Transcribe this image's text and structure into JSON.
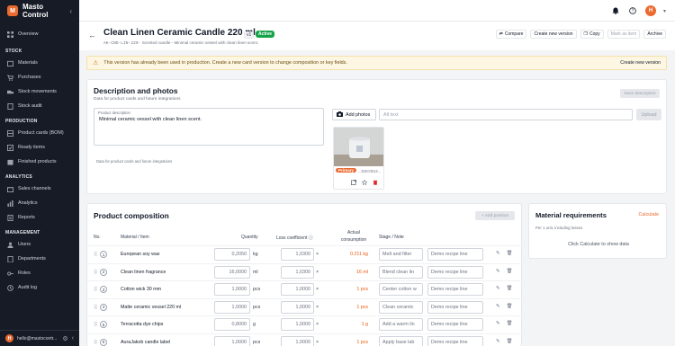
{
  "app": {
    "name": "Masto Control",
    "logo_letter": "M"
  },
  "sidebar": {
    "overview": "Overview",
    "sections": [
      {
        "title": "STOCK",
        "items": [
          "Materials",
          "Purchases",
          "Stock movements",
          "Stock audit"
        ]
      },
      {
        "title": "PRODUCTION",
        "items": [
          "Product cards (BOM)",
          "Ready items",
          "Finished products"
        ]
      },
      {
        "title": "ANALYTICS",
        "items": [
          "Sales channels",
          "Analytics",
          "Reports"
        ]
      },
      {
        "title": "MANAGEMENT",
        "items": [
          "Users",
          "Departments",
          "Roles",
          "Audit log"
        ]
      }
    ],
    "footer": {
      "avatar": "H",
      "email": "hello@mastocontr..."
    }
  },
  "topbar": {
    "avatar": "H"
  },
  "header": {
    "title": "Clean Linen Ceramic Candle 220 ml",
    "version": "v1",
    "status": "Active",
    "sku": "AK-CND-LIN-220",
    "subtitle": "Scented candle - Minimal ceramic vessel with clean linen scent.",
    "actions": {
      "compare": "Compare",
      "new_version": "Create new version",
      "copy": "Copy",
      "mark": "Mark as item",
      "archive": "Archive"
    }
  },
  "warning": {
    "message": "This version has already been used in production. Create a new card version to change composition or key fields.",
    "action": "Create new version"
  },
  "description": {
    "title": "Description and photos",
    "hint": "Data for product cards and future integrations",
    "save": "Save description",
    "field_label": "Product description",
    "field_value": "Minimal ceramic vessel with clean linen scent.",
    "field_hint": "Data for product cards and future integrations",
    "add_photos": "Add photos",
    "alt_placeholder": "Alt text",
    "upload": "Upload",
    "photo": {
      "badge": "Primary",
      "name": "...DSC0014..."
    }
  },
  "composition": {
    "title": "Product composition",
    "add_position": "+ Add position",
    "columns": {
      "no": "No.",
      "material": "Material / Item",
      "quantity": "Quantity",
      "loss": "Loss coefficient",
      "actual": "Actual consumption",
      "stage": "Stage / Note"
    },
    "rows": [
      {
        "no": "1",
        "material": "European soy wax",
        "qty": "0,2050",
        "unit": "kg",
        "loss": "1,0300",
        "actual": "0.211 kg",
        "stage": "Melt and filter",
        "note": "Demo recipe line"
      },
      {
        "no": "2",
        "material": "Clean linen fragrance",
        "qty": "16,0000",
        "unit": "ml",
        "loss": "1,0300",
        "actual": "16 ml",
        "stage": "Blend clean lin",
        "note": "Demo recipe line"
      },
      {
        "no": "3",
        "material": "Cotton wick 30 mm",
        "qty": "1,0000",
        "unit": "pcs",
        "loss": "1,0000",
        "actual": "1 pcs",
        "stage": "Center cotton w",
        "note": "Demo recipe line"
      },
      {
        "no": "4",
        "material": "Matte ceramic vessel 220 ml",
        "qty": "1,0000",
        "unit": "pcs",
        "loss": "1,0000",
        "actual": "1 pcs",
        "stage": "Clean ceramic",
        "note": "Demo recipe line"
      },
      {
        "no": "5",
        "material": "Terracotta dye chips",
        "qty": "0,8000",
        "unit": "g",
        "loss": "1,0000",
        "actual": "1 g",
        "stage": "Add a warm lin",
        "note": "Demo recipe line"
      },
      {
        "no": "6",
        "material": "AuraJakob candle label",
        "qty": "1,0000",
        "unit": "pcs",
        "loss": "1,0000",
        "actual": "1 pcs",
        "stage": "Apply base lab",
        "note": "Demo recipe line"
      }
    ]
  },
  "material_requirements": {
    "title": "Material requirements",
    "calculate": "Calculate",
    "hint": "Per 1 unit, including losses",
    "empty": "Click Calculate to show data"
  },
  "colors": {
    "accent": "#ea6a2f",
    "sidebar_bg": "#161b26",
    "active": "#16a34a",
    "warning_bg": "#fdf6e3"
  }
}
